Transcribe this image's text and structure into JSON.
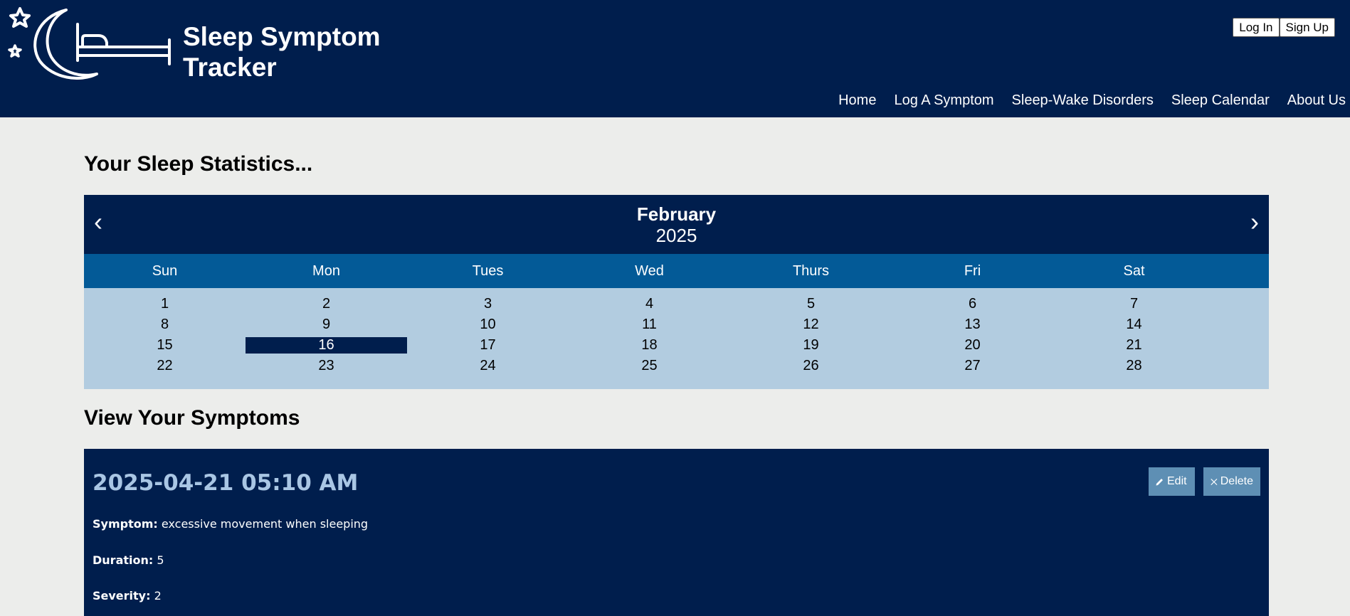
{
  "header": {
    "title_line1": "Sleep Symptom",
    "title_line2": "Tracker",
    "logo_icon": "moon-bed-stars-icon",
    "auth": {
      "login_label": "Log In",
      "signup_label": "Sign Up"
    },
    "nav": [
      {
        "label": "Home"
      },
      {
        "label": "Log A Symptom"
      },
      {
        "label": "Sleep-Wake Disorders"
      },
      {
        "label": "Sleep Calendar"
      },
      {
        "label": "About Us"
      }
    ]
  },
  "stats_heading": "Your Sleep Statistics...",
  "calendar": {
    "month": "February",
    "year": "2025",
    "prev_symbol": "‹",
    "next_symbol": "›",
    "weekdays": [
      "Sun",
      "Mon",
      "Tues",
      "Wed",
      "Thurs",
      "Fri",
      "Sat"
    ],
    "weeks": [
      [
        "1",
        "2",
        "3",
        "4",
        "5",
        "6",
        "7"
      ],
      [
        "8",
        "9",
        "10",
        "11",
        "12",
        "13",
        "14"
      ],
      [
        "15",
        "16",
        "17",
        "18",
        "19",
        "20",
        "21"
      ],
      [
        "22",
        "23",
        "24",
        "25",
        "26",
        "27",
        "28"
      ]
    ],
    "selected_day": "16"
  },
  "symptoms_heading": "View Your Symptoms",
  "symptom_entry": {
    "datetime": "2025-04-21 05:10 AM",
    "edit_label": "Edit",
    "delete_label": "Delete",
    "edit_icon": "pencil-icon",
    "delete_icon": "x-icon",
    "symptom_label": "Symptom:",
    "symptom_value": "excessive movement when sleeping",
    "duration_label": "Duration:",
    "duration_value": "5",
    "severity_label": "Severity:",
    "severity_value": "2"
  },
  "colors": {
    "navy": "#001e4d",
    "weekday_bar": "#035a97",
    "days_bg": "#b2cce0",
    "page_bg": "#ecedeb",
    "button_blue": "#5e8fb4",
    "datetime_text": "#a9c6e4"
  }
}
